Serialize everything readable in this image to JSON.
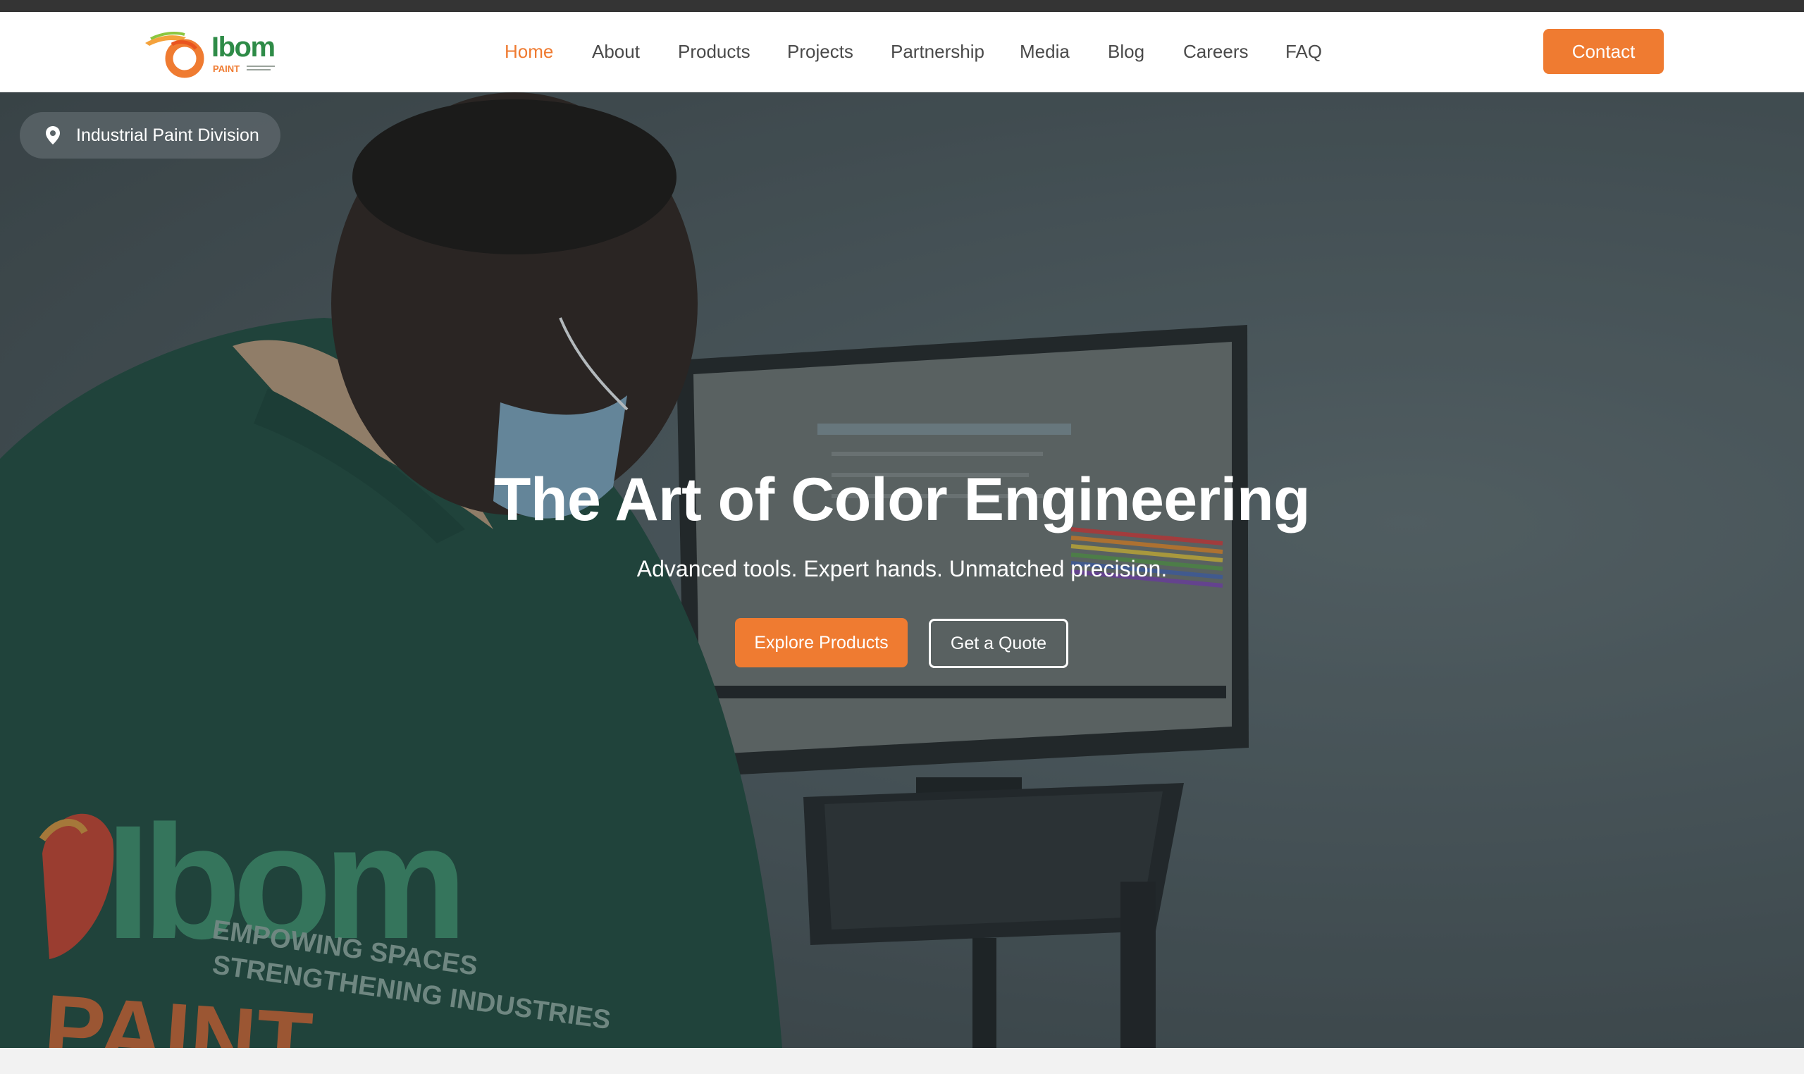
{
  "brand": {
    "name": "Ibom",
    "sub": "PAINT",
    "colors": {
      "accent": "#ef7b31",
      "green": "#2e8b47",
      "topbar": "#343434"
    }
  },
  "nav": {
    "items": [
      {
        "label": "Home",
        "active": true
      },
      {
        "label": "About"
      },
      {
        "label": "Products"
      },
      {
        "label": "Projects"
      },
      {
        "label": "Partnership"
      },
      {
        "label": "Media"
      },
      {
        "label": "Blog"
      },
      {
        "label": "Careers"
      },
      {
        "label": "FAQ"
      }
    ],
    "contact_label": "Contact"
  },
  "hero": {
    "badge": {
      "icon": "location-pin-icon",
      "label": "Industrial Paint Division"
    },
    "title": "The Art of Color Engineering",
    "subtitle": "Advanced tools. Expert hands. Unmatched precision.",
    "primary_cta": "Explore Products",
    "secondary_cta": "Get a Quote",
    "jacket_print": {
      "brand": "Ibom",
      "sub": "PAINT",
      "tag_line_1": "EMPOWING SPACES",
      "tag_line_2": "STRENGTHENING INDUSTRIES"
    }
  }
}
